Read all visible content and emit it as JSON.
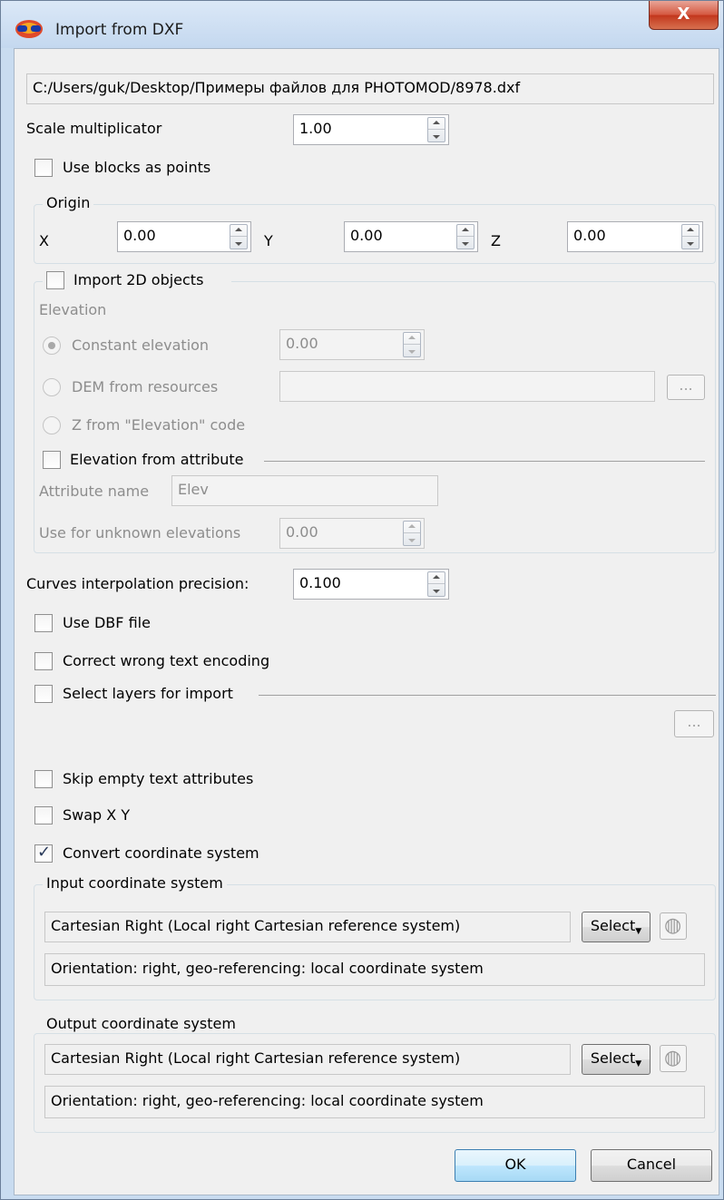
{
  "window": {
    "title": "Import from DXF",
    "close_label": "X"
  },
  "file_path": "C:/Users/guk/Desktop/Примеры файлов для PHOTOMOD/8978.dxf",
  "scale": {
    "label": "Scale multiplicator",
    "value": "1.00"
  },
  "use_blocks": {
    "label": "Use blocks as points",
    "checked": false
  },
  "origin": {
    "title": "Origin",
    "x_label": "X",
    "x_value": "0.00",
    "y_label": "Y",
    "y_value": "0.00",
    "z_label": "Z",
    "z_value": "0.00"
  },
  "import2d": {
    "label": "Import 2D objects",
    "elevation_label": "Elevation",
    "constant_label": "Constant elevation",
    "constant_value": "0.00",
    "dem_label": "DEM from resources",
    "dem_value": "",
    "dem_browse": "...",
    "zcode_label": "Z from \"Elevation\" code",
    "attr_elev_label": "Elevation from attribute",
    "attr_name_label": "Attribute name",
    "attr_name_value": "Elev",
    "unknown_label": "Use for unknown elevations",
    "unknown_value": "0.00"
  },
  "curves": {
    "label": "Curves interpolation precision:",
    "value": "0.100"
  },
  "use_dbf": {
    "label": "Use DBF file"
  },
  "correct_encoding": {
    "label": "Correct wrong text encoding"
  },
  "select_layers": {
    "label": "Select layers for import",
    "browse": "..."
  },
  "skip_empty": {
    "label": "Skip empty text attributes"
  },
  "swap_xy": {
    "label": "Swap X Y"
  },
  "convert_cs": {
    "label": "Convert coordinate system",
    "checked": true
  },
  "input_cs": {
    "title": "Input coordinate system",
    "name": "Cartesian Right (Local right Cartesian reference system)",
    "select_label": "Select",
    "orientation": "Orientation: right, geo-referencing: local coordinate system"
  },
  "output_cs": {
    "title": "Output coordinate system",
    "name": "Cartesian Right (Local right Cartesian reference system)",
    "select_label": "Select",
    "orientation": "Orientation: right, geo-referencing: local coordinate system"
  },
  "buttons": {
    "ok": "OK",
    "cancel": "Cancel"
  }
}
